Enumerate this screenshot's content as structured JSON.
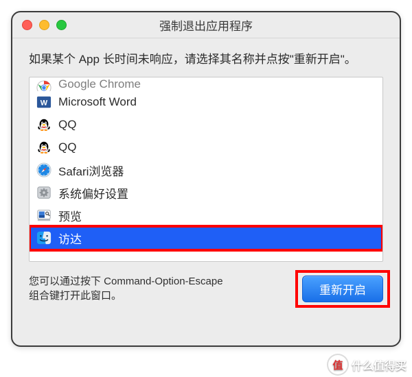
{
  "window": {
    "title": "强制退出应用程序",
    "instruction": "如果某个 App 长时间未响应，请选择其名称并点按\"重新开启\"。",
    "hint_line1": "您可以通过按下 Command-Option-Escape",
    "hint_line2": "组合键打开此窗口。",
    "button_label": "重新开启"
  },
  "apps": [
    {
      "name": "Google Chrome",
      "icon": "chrome-icon",
      "cut": true
    },
    {
      "name": "Microsoft Word",
      "icon": "word-icon"
    },
    {
      "name": "QQ",
      "icon": "qq-icon"
    },
    {
      "name": "QQ",
      "icon": "qq-icon"
    },
    {
      "name": "Safari浏览器",
      "icon": "safari-icon"
    },
    {
      "name": "系统偏好设置",
      "icon": "sysprefs-icon"
    },
    {
      "name": "预览",
      "icon": "preview-icon"
    },
    {
      "name": "访达",
      "icon": "finder-icon",
      "selected": true
    }
  ],
  "colors": {
    "selection": "#1f5ff6",
    "highlight": "#ff0000",
    "button_top": "#4aa1ff",
    "button_bottom": "#196fe8"
  },
  "watermark": {
    "badge": "值",
    "text": "什么值得买"
  }
}
